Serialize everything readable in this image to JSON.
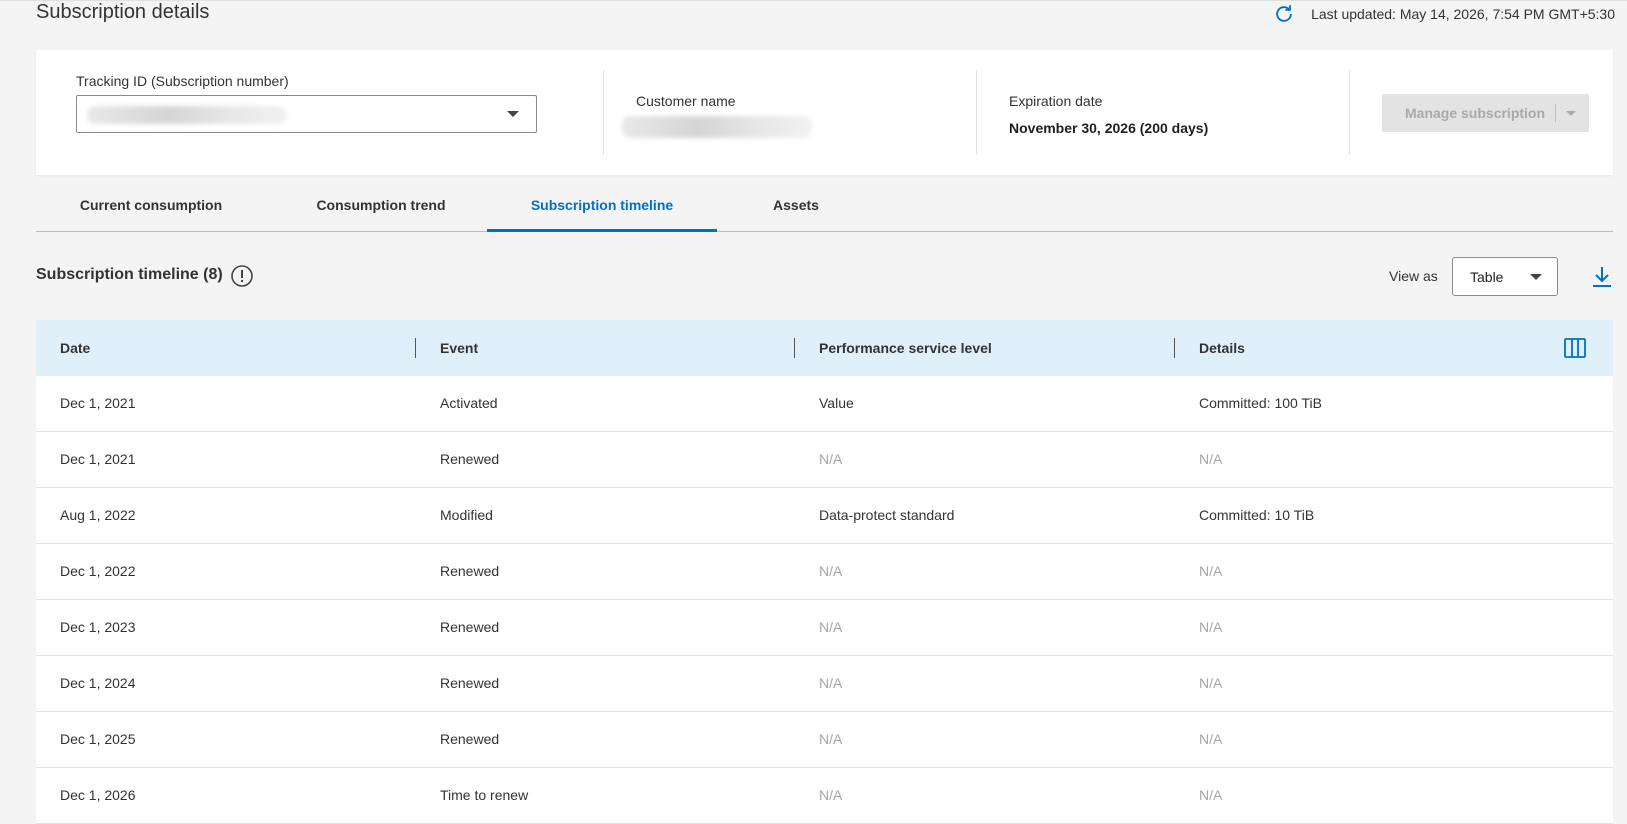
{
  "header": {
    "title": "Subscription details",
    "last_updated": "Last updated: May 14, 2026, 7:54 PM GMT+5:30"
  },
  "summary": {
    "tracking_label": "Tracking ID (Subscription number)",
    "customer_label": "Customer name",
    "expiration_label": "Expiration date",
    "expiration_value": "November 30, 2026 (200 days)",
    "manage_label": "Manage subscription"
  },
  "tabs": [
    {
      "label": "Current consumption"
    },
    {
      "label": "Consumption trend"
    },
    {
      "label": "Subscription timeline",
      "active": true
    },
    {
      "label": "Assets"
    }
  ],
  "timeline": {
    "title": "Subscription timeline (8)",
    "view_as_label": "View as",
    "view_as_value": "Table",
    "columns": [
      "Date",
      "Event",
      "Performance service level",
      "Details"
    ],
    "rows": [
      {
        "date": "Dec 1, 2021",
        "event": "Activated",
        "level": "Value",
        "details": "Committed: 100 TiB"
      },
      {
        "date": "Dec 1, 2021",
        "event": "Renewed",
        "level": "N/A",
        "details": "N/A"
      },
      {
        "date": "Aug 1, 2022",
        "event": "Modified",
        "level": "Data-protect standard",
        "details": "Committed: 10 TiB"
      },
      {
        "date": "Dec 1, 2022",
        "event": "Renewed",
        "level": "N/A",
        "details": "N/A"
      },
      {
        "date": "Dec 1, 2023",
        "event": "Renewed",
        "level": "N/A",
        "details": "N/A"
      },
      {
        "date": "Dec 1, 2024",
        "event": "Renewed",
        "level": "N/A",
        "details": "N/A"
      },
      {
        "date": "Dec 1, 2025",
        "event": "Renewed",
        "level": "N/A",
        "details": "N/A"
      },
      {
        "date": "Dec 1, 2026",
        "event": "Time to renew",
        "level": "N/A",
        "details": "N/A"
      }
    ]
  },
  "icons": {
    "refresh": "refresh-icon",
    "info": "info-icon",
    "download": "download-icon",
    "columns": "columns-icon"
  },
  "colors": {
    "accent": "#0072c6",
    "table_header_bg": "#dff0fb",
    "muted_text": "#a8a8a8"
  }
}
